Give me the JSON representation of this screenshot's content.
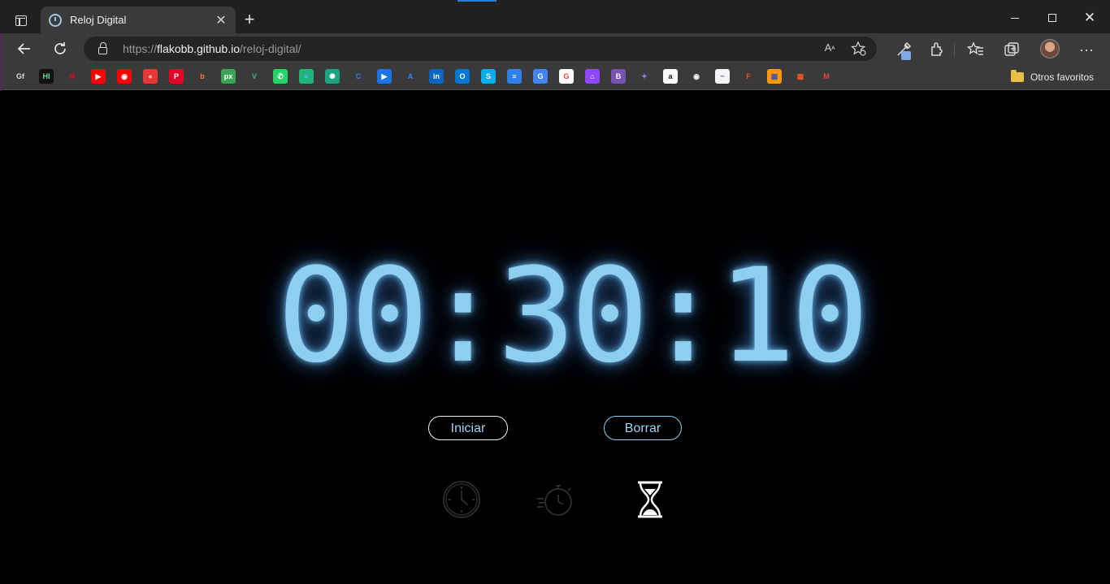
{
  "browser": {
    "tab_title": "Reloj Digital",
    "tab_close": "✕",
    "new_tab": "+",
    "window": {
      "minimize": "",
      "maximize": "",
      "close": "✕"
    },
    "url_prefix": "https://",
    "url_host": "flakobb.github.io",
    "url_path": "/reloj-digital/",
    "read_aloud": "Aͅ",
    "more": "···",
    "bookmarks": [
      {
        "name": "gf",
        "text": "Gf",
        "bg": "#3a3a3a",
        "fg": "#dcdcdc"
      },
      {
        "name": "hi",
        "text": "HI",
        "bg": "#111111",
        "fg": "#5fe0a0"
      },
      {
        "name": "netflix",
        "text": "N",
        "bg": "#3a3a3a",
        "fg": "#e50914"
      },
      {
        "name": "youtube",
        "text": "▶",
        "bg": "#ff0000",
        "fg": "#ffffff"
      },
      {
        "name": "youtube-music",
        "text": "◉",
        "bg": "#ff0000",
        "fg": "#ffffff"
      },
      {
        "name": "red-circle",
        "text": "●",
        "bg": "#e53935",
        "fg": "#ffb3b3"
      },
      {
        "name": "pinterest",
        "text": "P",
        "bg": "#e60023",
        "fg": "#ffffff"
      },
      {
        "name": "behance-b",
        "text": "b",
        "bg": "#3a3a3a",
        "fg": "#ff7a30"
      },
      {
        "name": "px",
        "text": "px",
        "bg": "#3aa655",
        "fg": "#ffffff"
      },
      {
        "name": "vue",
        "text": "V",
        "bg": "#3a3a3a",
        "fg": "#41b883"
      },
      {
        "name": "whatsapp",
        "text": "✆",
        "bg": "#25d366",
        "fg": "#ffffff"
      },
      {
        "name": "chat-bubbles",
        "text": "●",
        "bg": "#1fb57a",
        "fg": "#5fa8ff"
      },
      {
        "name": "chatgpt",
        "text": "✺",
        "bg": "#19a37f",
        "fg": "#ffffff"
      },
      {
        "name": "c-blue",
        "text": "C",
        "bg": "#3a3a3a",
        "fg": "#3f7cff"
      },
      {
        "name": "play-blue",
        "text": "▶",
        "bg": "#1a73e8",
        "fg": "#ffffff"
      },
      {
        "name": "azure",
        "text": "A",
        "bg": "#3a3a3a",
        "fg": "#2e8cff"
      },
      {
        "name": "linkedin",
        "text": "in",
        "bg": "#0a66c2",
        "fg": "#ffffff"
      },
      {
        "name": "outlook",
        "text": "O",
        "bg": "#0078d4",
        "fg": "#ffffff"
      },
      {
        "name": "skype-s",
        "text": "S",
        "bg": "#00aff0",
        "fg": "#ffffff"
      },
      {
        "name": "blue-doc",
        "text": "≡",
        "bg": "#2f80ed",
        "fg": "#ffffff"
      },
      {
        "name": "translate",
        "text": "G",
        "bg": "#4285f4",
        "fg": "#ffffff"
      },
      {
        "name": "google-circle",
        "text": "G",
        "bg": "#ffffff",
        "fg": "#ea4335"
      },
      {
        "name": "twitch",
        "text": "⌂",
        "bg": "#9146ff",
        "fg": "#ffffff"
      },
      {
        "name": "bootstrap",
        "text": "B",
        "bg": "#7952b3",
        "fg": "#ffffff"
      },
      {
        "name": "planet",
        "text": "✦",
        "bg": "#3a3a3a",
        "fg": "#9a7cf2"
      },
      {
        "name": "amazon",
        "text": "a",
        "bg": "#ffffff",
        "fg": "#111111"
      },
      {
        "name": "github",
        "text": "◉",
        "bg": "#3a3a3a",
        "fg": "#f5f5f5"
      },
      {
        "name": "docs-white",
        "text": "~",
        "bg": "#f5f5f5",
        "fg": "#2c6bd6"
      },
      {
        "name": "figma",
        "text": "F",
        "bg": "#3a3a3a",
        "fg": "#f24e1e"
      },
      {
        "name": "rainbow",
        "text": "▦",
        "bg": "#ff9800",
        "fg": "#3f51b5"
      },
      {
        "name": "microsoft",
        "text": "▦",
        "bg": "#3a3a3a",
        "fg": "#f25022"
      },
      {
        "name": "gmail",
        "text": "M",
        "bg": "#3a3a3a",
        "fg": "#ea4335"
      }
    ],
    "folder_label": "Otros favoritos"
  },
  "app": {
    "time_display": "00:30:10",
    "start_label": "Iniciar",
    "clear_label": "Borrar",
    "modes": [
      "clock",
      "stopwatch",
      "timer"
    ],
    "active_mode": "timer"
  },
  "colors": {
    "digits": "#8ecff0",
    "background": "#000000",
    "inactive_icon": "#2a2a2a",
    "active_icon": "#ffffff"
  }
}
